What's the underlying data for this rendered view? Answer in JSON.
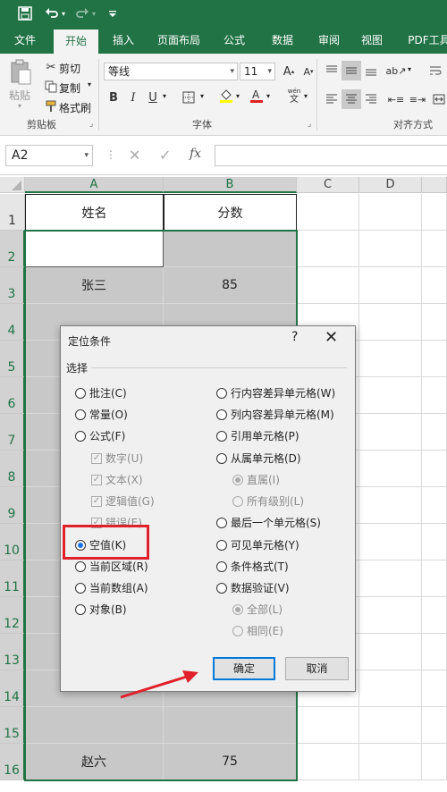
{
  "titlebar": {
    "icons": [
      "save-icon",
      "undo-icon",
      "redo-icon",
      "customize-qat-icon"
    ]
  },
  "tabs": [
    "文件",
    "开始",
    "插入",
    "页面布局",
    "公式",
    "数据",
    "审阅",
    "视图",
    "PDF工具"
  ],
  "ribbon": {
    "paste_label": "粘贴",
    "cut_label": "剪切",
    "copy_label": "复制",
    "format_painter_label": "格式刷",
    "clipboard_group": "剪贴板",
    "font_name": "等线",
    "font_size": "11",
    "font_group": "字体",
    "align_group": "对齐方式"
  },
  "formula_bar": {
    "name_box": "A2",
    "fx": "fx"
  },
  "columns": [
    "A",
    "B",
    "C",
    "D"
  ],
  "rows": [
    "1",
    "2",
    "3",
    "4",
    "5",
    "6",
    "7",
    "8",
    "9",
    "10",
    "11",
    "12",
    "13",
    "14",
    "15",
    "16"
  ],
  "cells": {
    "a1": "姓名",
    "b1": "分数",
    "a3": "张三",
    "b3": "85",
    "a16": "赵六",
    "b16": "75"
  },
  "dialog": {
    "title": "定位条件",
    "help": "?",
    "close": "✕",
    "section": "选择",
    "left_options": [
      {
        "label": "批注(C)",
        "state": "off",
        "type": "radio"
      },
      {
        "label": "常量(O)",
        "state": "off",
        "type": "radio"
      },
      {
        "label": "公式(F)",
        "state": "off",
        "type": "radio"
      },
      {
        "label": "数字(U)",
        "state": "checked-disabled",
        "type": "check"
      },
      {
        "label": "文本(X)",
        "state": "checked-disabled",
        "type": "check"
      },
      {
        "label": "逻辑值(G)",
        "state": "checked-disabled",
        "type": "check"
      },
      {
        "label": "错误(E)",
        "state": "checked-disabled",
        "type": "check"
      },
      {
        "label": "空值(K)",
        "state": "on",
        "type": "radio"
      },
      {
        "label": "当前区域(R)",
        "state": "off",
        "type": "radio"
      },
      {
        "label": "当前数组(A)",
        "state": "off",
        "type": "radio"
      },
      {
        "label": "对象(B)",
        "state": "off",
        "type": "radio"
      }
    ],
    "right_options": [
      {
        "label": "行内容差异单元格(W)",
        "state": "off",
        "type": "radio"
      },
      {
        "label": "列内容差异单元格(M)",
        "state": "off",
        "type": "radio"
      },
      {
        "label": "引用单元格(P)",
        "state": "off",
        "type": "radio"
      },
      {
        "label": "从属单元格(D)",
        "state": "off",
        "type": "radio"
      },
      {
        "label": "直属(I)",
        "state": "on-disabled",
        "type": "radio"
      },
      {
        "label": "所有级别(L)",
        "state": "off-disabled",
        "type": "radio"
      },
      {
        "label": "最后一个单元格(S)",
        "state": "off",
        "type": "radio"
      },
      {
        "label": "可见单元格(Y)",
        "state": "off",
        "type": "radio"
      },
      {
        "label": "条件格式(T)",
        "state": "off",
        "type": "radio"
      },
      {
        "label": "数据验证(V)",
        "state": "off",
        "type": "radio"
      },
      {
        "label": "全部(L)",
        "state": "on-disabled",
        "type": "radio"
      },
      {
        "label": "相同(E)",
        "state": "off-disabled",
        "type": "radio"
      }
    ],
    "ok": "确定",
    "cancel": "取消"
  },
  "colors": {
    "excel_green": "#217346",
    "highlight_red": "#e0202a",
    "gray_fill": "#c8c8c8"
  }
}
